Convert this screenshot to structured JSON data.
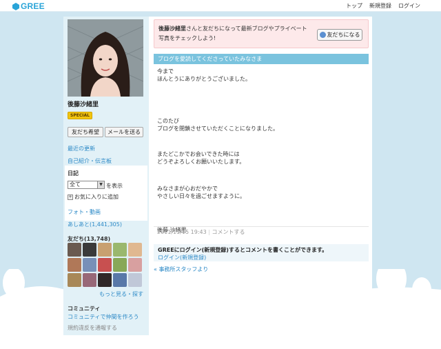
{
  "header": {
    "logo_text": "GREE",
    "nav": [
      "トップ",
      "新規登録",
      "ログイン"
    ]
  },
  "profile": {
    "name": "後藤沙緒里",
    "badge": "SPECIAL",
    "buttons": [
      "友だち希望",
      "メールを送る"
    ],
    "links": [
      "最近の更新",
      "自己紹介・伝言板"
    ],
    "diary": {
      "title": "日記",
      "select_value": "全て",
      "show_label": "を表示",
      "favorite_label": "お気に入りに追加"
    },
    "photo_link": "フォト・動画",
    "footprints": "あしあと(1,441,305)",
    "friends_title": "友だち(13,748)",
    "more_link": "もっと見る・探す",
    "community_title": "コミュニティ",
    "community_link": "コミュニティで仲間を作ろう",
    "report_link": "規約違反を通報する"
  },
  "notice": {
    "name": "後藤沙緒里",
    "text": "さんと友だちになって最新ブログやプライベート写真をチェックしよう!",
    "button": "友だちになる"
  },
  "blog": {
    "title": "ブログを愛読してくださっていたみなさま",
    "paragraphs": [
      "今まで\nほんとうにありがとうございました。",
      "このたび\nブログを閉鎖させていただくことになりました。",
      "またどこかでお会いできた時には\nどうぞよろしくお願いいたします。",
      "みなさまが心おだやかで\nやさしい日々を過ごせますように。",
      "後藤 沙緒里"
    ],
    "date": "2011/11/15 19:43",
    "comment_label": "コメントする",
    "login_prompt": "GREEにログイン(新規登録)するとコメントを書くことができます。",
    "login_link": "ログイン(新規登録)",
    "back_link": "« 事務所スタッフより"
  },
  "colors": {
    "accent": "#2aa4d8",
    "link": "#2a88c6",
    "blog_header": "#7ac3de",
    "notice_bg": "#fde9ea",
    "badge": "#f1c40f"
  }
}
